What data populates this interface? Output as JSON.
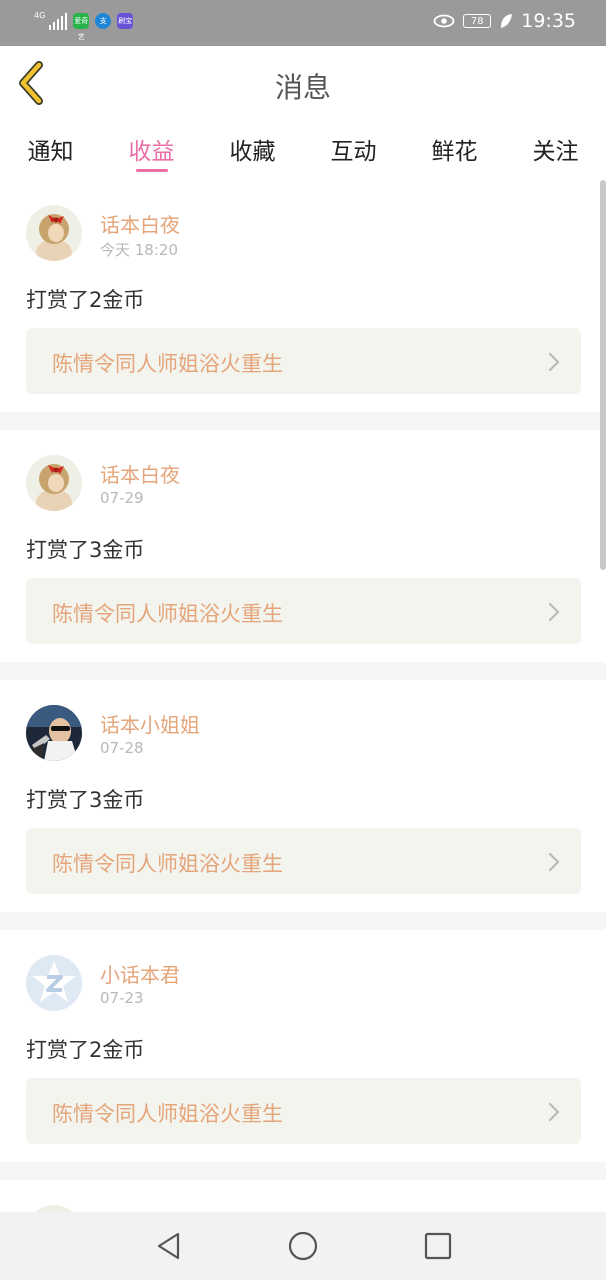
{
  "status_bar": {
    "network": "4G",
    "apps": [
      {
        "icon": "iqiyi-icon",
        "label": "爱奇艺",
        "color": "#27b24a"
      },
      {
        "icon": "alipay-icon",
        "label": "支",
        "color": "#1f86d6"
      },
      {
        "icon": "app-icon",
        "label": "刷宝",
        "color": "#6a52d6"
      }
    ],
    "battery": "78",
    "time": "19:35"
  },
  "header": {
    "title": "消息",
    "back_icon": "back-arrow-icon"
  },
  "tabs": [
    {
      "label": "通知",
      "active": false
    },
    {
      "label": "收益",
      "active": true
    },
    {
      "label": "收藏",
      "active": false
    },
    {
      "label": "互动",
      "active": false
    },
    {
      "label": "鲜花",
      "active": false
    },
    {
      "label": "关注",
      "active": false
    }
  ],
  "messages": [
    {
      "user": "话本白夜",
      "date": "今天 18:20",
      "action": "打赏了2金币",
      "book": "陈情令同人师姐浴火重生",
      "avatar": "doll-avatar"
    },
    {
      "user": "话本白夜",
      "date": "07-29",
      "action": "打赏了3金币",
      "book": "陈情令同人师姐浴火重生",
      "avatar": "doll-avatar"
    },
    {
      "user": "话本小姐姐",
      "date": "07-28",
      "action": "打赏了3金币",
      "book": "陈情令同人师姐浴火重生",
      "avatar": "driver-avatar"
    },
    {
      "user": "小话本君",
      "date": "07-23",
      "action": "打赏了2金币",
      "book": "陈情令同人师姐浴火重生",
      "avatar": "star-z-avatar"
    }
  ],
  "colors": {
    "accent": "#e96fa6",
    "name": "#e5a57a",
    "book_bg": "#f4f4ef",
    "status_bar": "#9a9a9a"
  }
}
